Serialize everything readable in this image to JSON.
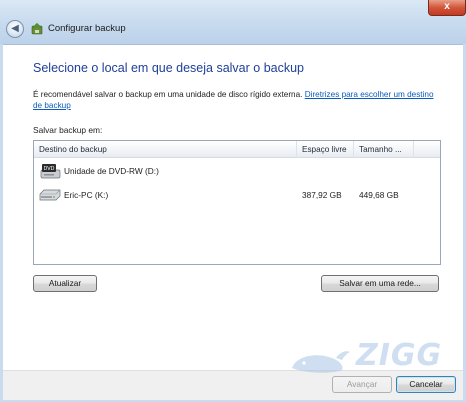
{
  "window": {
    "title": "Configurar backup",
    "close_glyph": "x"
  },
  "main": {
    "heading": "Selecione o local em que deseja salvar o backup",
    "info_text": "É recomendável salvar o backup em uma unidade de disco rígido externa.",
    "info_link": "Diretrizes para escolher um destino de backup",
    "save_label": "Salvar backup em:"
  },
  "table": {
    "columns": [
      "Destino do backup",
      "Espaço livre",
      "Tamanho ..."
    ],
    "rows": [
      {
        "icon": "dvd-drive-icon",
        "name": "Unidade de DVD-RW (D:)",
        "free": "",
        "size": ""
      },
      {
        "icon": "hard-drive-icon",
        "name": "Eric-PC (K:)",
        "free": "387,92 GB",
        "size": "449,68 GB"
      }
    ]
  },
  "buttons": {
    "refresh": "Atualizar",
    "network": "Salvar em uma rede...",
    "next": "Avançar",
    "cancel": "Cancelar"
  },
  "watermark": {
    "text": "ZIGG"
  },
  "colors": {
    "heading": "#1f3f99",
    "link": "#0a5bbd",
    "close": "#c03a20"
  }
}
